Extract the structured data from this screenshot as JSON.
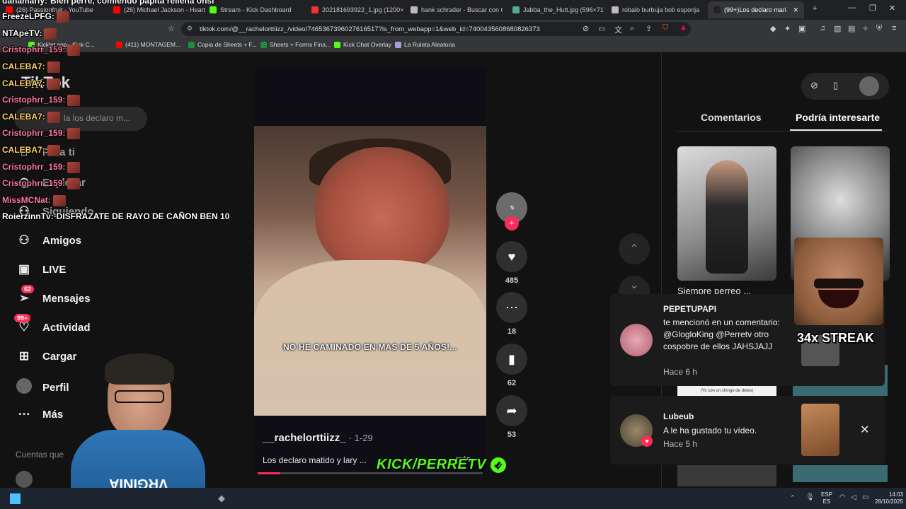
{
  "browser": {
    "tabs": [
      {
        "label": "(26) Passionfruit - YouTube",
        "color": "#ff0000"
      },
      {
        "label": "(26) Michael Jackson - Heartbr",
        "color": "#ff0000"
      },
      {
        "label": "Stream - Kick Dashboard",
        "color": "#53fc18"
      },
      {
        "label": "202181693922_1.jpg (1200×90",
        "color": "#e33"
      },
      {
        "label": "hank schrader - Buscar con Go",
        "color": "#bbb"
      },
      {
        "label": "Jabba_the_Hutt.jpg (596×717)",
        "color": "#5a8"
      },
      {
        "label": "robalo burbuja bob esponja",
        "color": "#bbb"
      },
      {
        "label": "(99+)Los declaro mari",
        "color": "#222"
      }
    ],
    "url": "tiktok.com/@__rachelorttiizz_/video/7465367396027616517?is_from_webapp=1&web_id=7400435608680826373",
    "bookmarks": [
      {
        "label": "Kicklet.app - Kick C..."
      },
      {
        "label": "(411) MONTAGEM..."
      },
      {
        "label": "Copia de Sheets + F..."
      },
      {
        "label": "Sheets + Forms Fina..."
      },
      {
        "label": "Kick Chat Overlay"
      },
      {
        "label": "La Ruleta Aleatoria"
      }
    ]
  },
  "chat": [
    {
      "user": "danamarly:",
      "text": "Bien perre, comiendo papita rellena onsi",
      "color": "#ffffff"
    },
    {
      "user": "FreezeLPFG:",
      "text": "",
      "color": "#ffffff"
    },
    {
      "user": "NTApeTV:",
      "text": "",
      "color": "#ffffff"
    },
    {
      "user": "Cristophrr_159:",
      "text": "",
      "color": "#ff7aa0"
    },
    {
      "user": "CALEBA7:",
      "text": "",
      "color": "#ffd166"
    },
    {
      "user": "CALEBA7:",
      "text": "",
      "color": "#ffd166"
    },
    {
      "user": "Cristophrr_159:",
      "text": "",
      "color": "#ff7aa0"
    },
    {
      "user": "CALEBA7:",
      "text": "",
      "color": "#ffd166"
    },
    {
      "user": "Cristophrr_159:",
      "text": "",
      "color": "#ff7aa0"
    },
    {
      "user": "CALEBA7:",
      "text": "",
      "color": "#ffd166"
    },
    {
      "user": "Cristophrr_159:",
      "text": "",
      "color": "#ff7aa0"
    },
    {
      "user": "Cristophrr_159:",
      "text": "",
      "color": "#ff7aa0"
    },
    {
      "user": "MissMCNat:",
      "text": "",
      "color": "#ff7aa0"
    },
    {
      "user": "RoierzinnTv:",
      "text": "DISFRAZATE DE RAYO DE CAÑON BEN 10",
      "color": "#ffffff"
    }
  ],
  "tiktok": {
    "logo": "TikTok",
    "search_placeholder": "la los declaro m...",
    "nav": [
      {
        "label": "Para ti",
        "icon": "home-icon"
      },
      {
        "label": "Explorar",
        "icon": "compass-icon"
      },
      {
        "label": "Siguiendo",
        "icon": "following-icon"
      },
      {
        "label": "Amigos",
        "icon": "friends-icon"
      },
      {
        "label": "LIVE",
        "icon": "live-icon"
      },
      {
        "label": "Mensajes",
        "icon": "messages-icon",
        "badge": "62"
      },
      {
        "label": "Actividad",
        "icon": "activity-icon",
        "badge": "99+"
      },
      {
        "label": "Cargar",
        "icon": "upload-icon"
      },
      {
        "label": "Perfil",
        "icon": "profile-icon"
      },
      {
        "label": "Más",
        "icon": "more-icon"
      }
    ],
    "accounts_label": "Cuentas que",
    "video": {
      "subtitle": "NO HE CAMINADO EN MAS DE 5 AÑOS!...",
      "author": "__rachelorttiizz_",
      "date": "· 1-29",
      "description": "Los declaro matido y lary ...",
      "more": "más",
      "progress": 0.1
    },
    "actions": {
      "likes": "485",
      "comments": "18",
      "saves": "62",
      "shares": "53"
    },
    "right_panel": {
      "tab_comments": "Comentarios",
      "tab_suggested": "Podría interesarte",
      "card1_title": "Siempre perreo ...",
      "mini_caption": "(Yo con un chingo de dotes)"
    },
    "notifications": [
      {
        "name": "PEPETUPAPI",
        "message": "te mencionó en un comentario: @GlogloKing @Perretv otro cospobre de ellos JAHSJAJJ",
        "time": "Hace 6 h"
      },
      {
        "name": "Lubeub",
        "message": "A le ha gustado tu vídeo.",
        "time": "Hace 5 h"
      }
    ]
  },
  "overlay": {
    "kick_label": "KICK/PERRETV",
    "streak": "34x STREAK"
  },
  "taskbar": {
    "lang_top": "ESP",
    "lang_bottom": "ES",
    "time": "14:03",
    "date": "28/10/2025"
  }
}
